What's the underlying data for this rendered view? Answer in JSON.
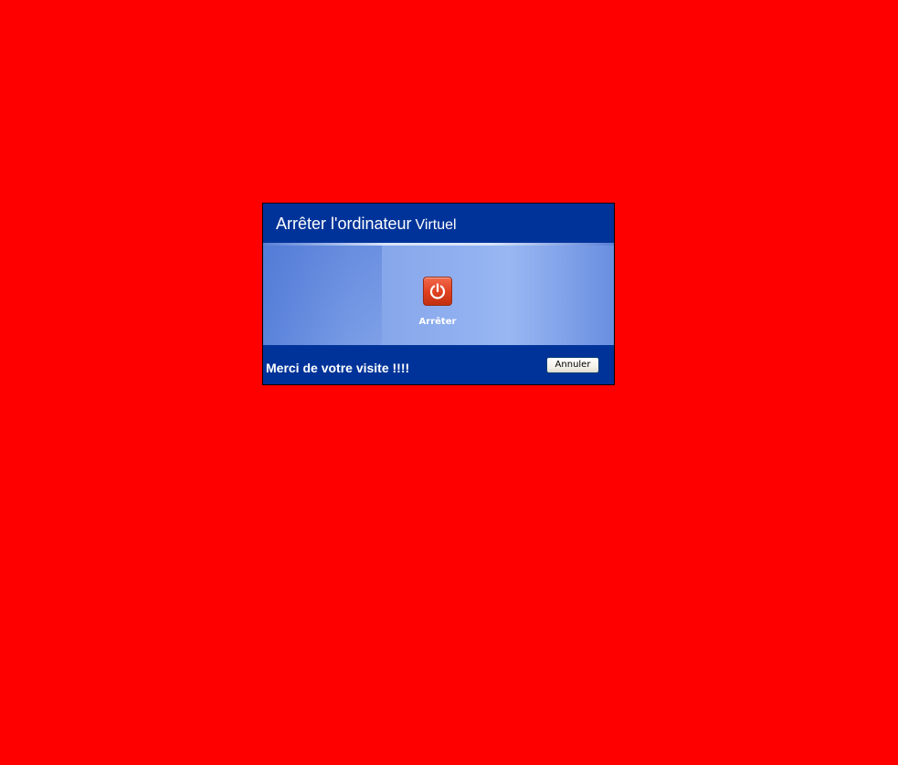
{
  "background_color": "#ff0000",
  "dialog": {
    "title": "Arrêter l'ordinateur",
    "title_suffix": "Virtuel",
    "header_color": "#003399",
    "options": [
      {
        "label": "Arrêter",
        "icon": "power-icon",
        "icon_color": "#de3f1f"
      }
    ],
    "footer": {
      "message": "Merci de votre visite !!!!",
      "cancel_label": "Annuler"
    }
  }
}
